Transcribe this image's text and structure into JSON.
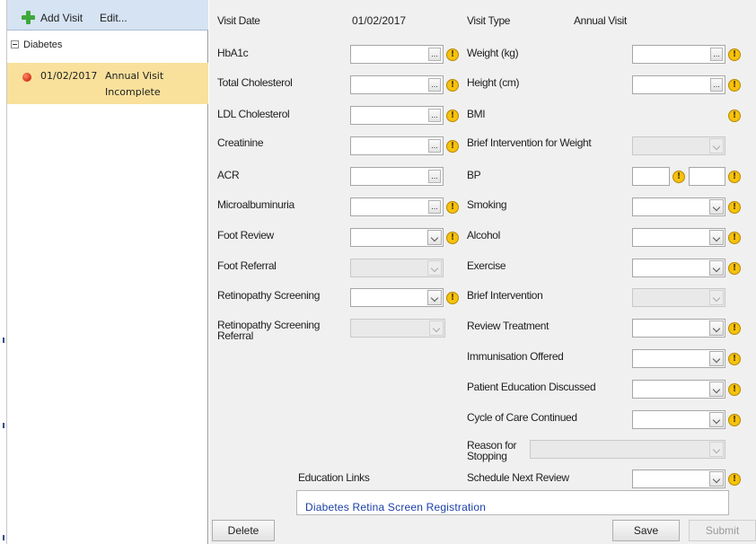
{
  "toolbar": {
    "add_visit": "Add Visit",
    "edit": "Edit...",
    "add_icon": "plus-icon"
  },
  "tree": {
    "root": "Diabetes",
    "visit": {
      "date": "01/02/2017",
      "type": "Annual Visit",
      "status": "Incomplete",
      "status_color": "#d33212",
      "highlight": "#f9e19c"
    }
  },
  "header": {
    "visit_date_label": "Visit Date",
    "visit_date_value": "01/02/2017",
    "visit_type_label": "Visit Type",
    "visit_type_value": "Annual Visit"
  },
  "fields": {
    "hba1c": "HbA1c",
    "total_chol": "Total Cholesterol",
    "ldl": "LDL Cholesterol",
    "creatinine": "Creatinine",
    "acr": "ACR",
    "microalb": "Microalbuminuria",
    "foot_review": "Foot Review",
    "foot_referral": "Foot Referral",
    "retino_screening": "Retinopathy Screening",
    "retino_referral_1": "Retinopathy Screening",
    "retino_referral_2": "Referral",
    "weight": "Weight (kg)",
    "height": "Height (cm)",
    "bmi": "BMI",
    "brief_weight": "Brief Intervention for Weight",
    "bp": "BP",
    "smoking": "Smoking",
    "alcohol": "Alcohol",
    "exercise": "Exercise",
    "brief_intervention": "Brief Intervention",
    "review_treatment": "Review Treatment",
    "immunisation": "Immunisation Offered",
    "patient_education": "Patient Education Discussed",
    "cycle_of_care": "Cycle of Care Continued",
    "reason_stop_1": "Reason for",
    "reason_stop_2": "Stopping",
    "schedule_review": "Schedule Next Review"
  },
  "browse_glyph": "...",
  "warning_glyph": "!",
  "education": {
    "label": "Education Links",
    "link": "Diabetes Retina Screen Registration",
    "link_color": "#1a3ea8"
  },
  "buttons": {
    "delete": "Delete",
    "save": "Save",
    "submit": "Submit"
  },
  "colors": {
    "panel_bg": "#f0f0f0",
    "toolbar_bg": "#d6e3f3",
    "warning": "#f5c20d"
  }
}
